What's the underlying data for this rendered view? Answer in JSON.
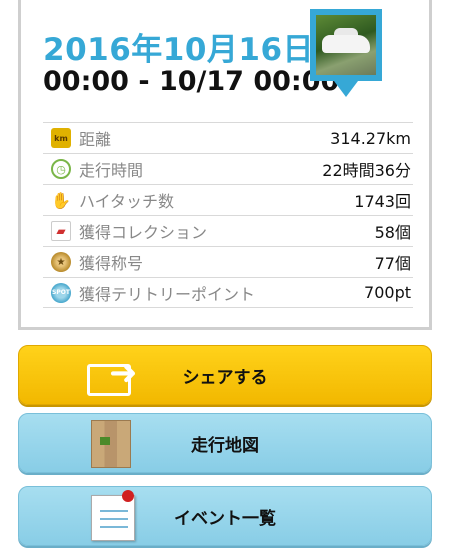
{
  "summary": {
    "date": "2016年10月16日",
    "range": "00:00 - 10/17 00:00",
    "accent_color": "#36a8d6"
  },
  "stats": [
    {
      "icon": "km-badge-icon",
      "icon_text": "km",
      "label": "距離",
      "value": "314.27km"
    },
    {
      "icon": "clock-icon",
      "icon_text": "",
      "label": "走行時間",
      "value": "22時間36分"
    },
    {
      "icon": "hand-wave-icon",
      "icon_text": "",
      "label": "ハイタッチ数",
      "value": "1743回"
    },
    {
      "icon": "car-card-icon",
      "icon_text": "",
      "label": "獲得コレクション",
      "value": "58個"
    },
    {
      "icon": "medal-icon",
      "icon_text": "",
      "label": "獲得称号",
      "value": "77個"
    },
    {
      "icon": "spot-badge-icon",
      "icon_text": "SPOT",
      "label": "獲得テリトリーポイント",
      "value": "700pt"
    }
  ],
  "buttons": {
    "share": {
      "label": "シェアする",
      "icon": "share-arrow-icon",
      "color": "#f6c300"
    },
    "map": {
      "label": "走行地図",
      "icon": "map-icon",
      "color": "#8fd0e8"
    },
    "events": {
      "label": "イベント一覧",
      "icon": "memo-pin-icon",
      "color": "#8fd0e8"
    }
  }
}
